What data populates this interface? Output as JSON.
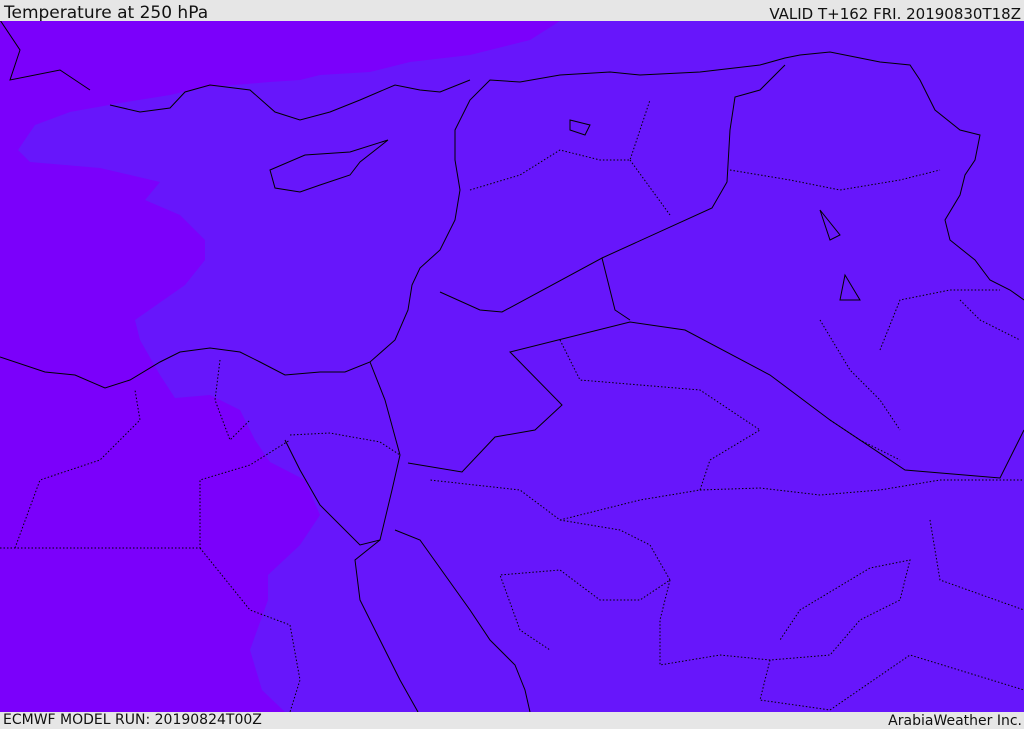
{
  "header": {
    "title": "Temperature at 250 hPa",
    "valid": "VALID T+162 FRI. 20190830T18Z"
  },
  "footer": {
    "model_run": "ECMWF MODEL RUN: 20190824T00Z",
    "brand": "ArabiaWeather Inc."
  },
  "colors": {
    "cold_band": "#7b00fb",
    "warm_band": "#6716fb",
    "coastline": "#000000",
    "background": "#e6e6e6"
  }
}
